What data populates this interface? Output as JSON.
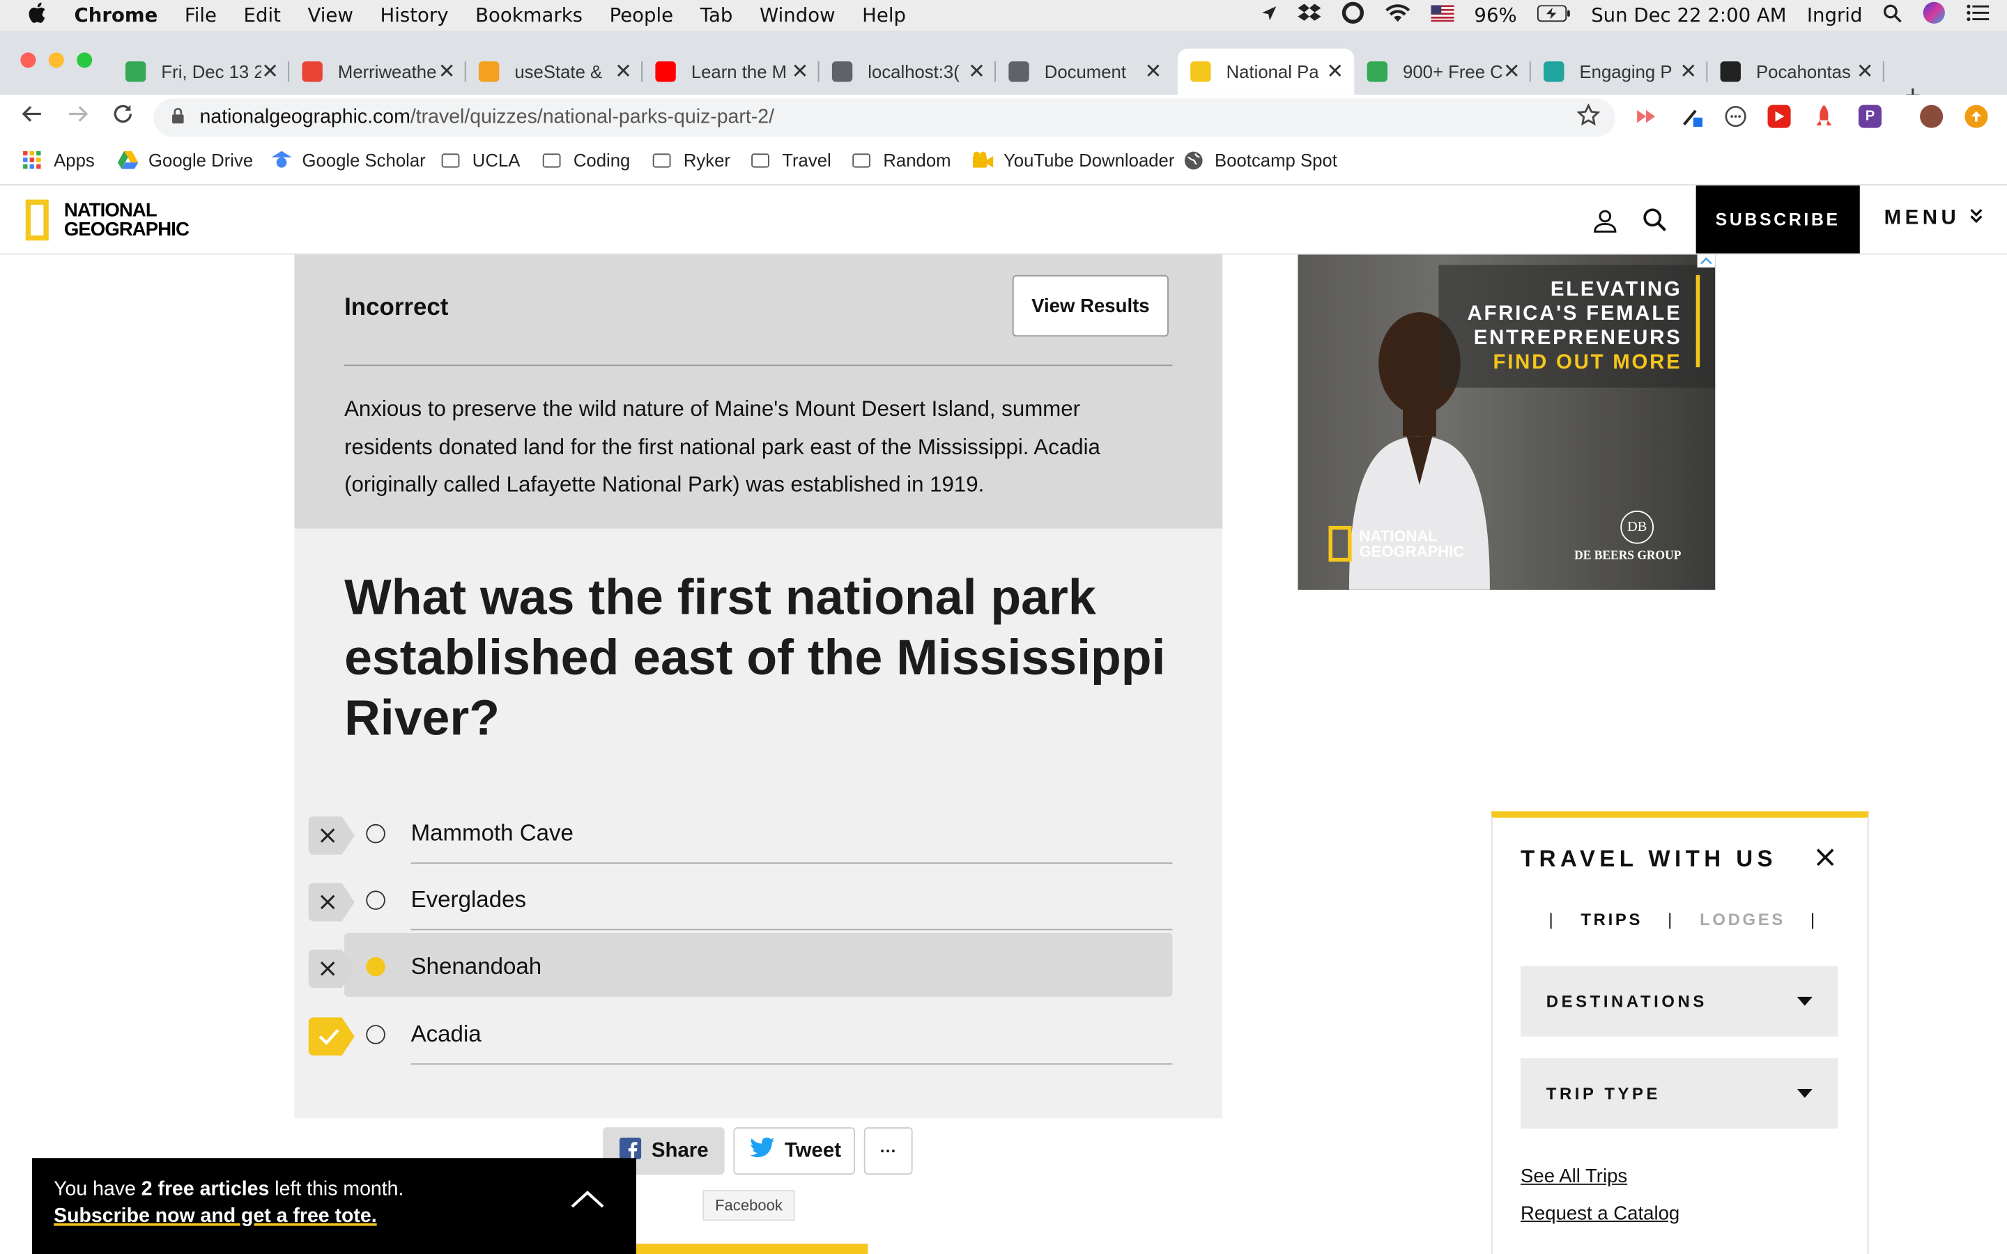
{
  "menubar": {
    "app": "Chrome",
    "items": [
      "File",
      "Edit",
      "View",
      "History",
      "Bookmarks",
      "People",
      "Tab",
      "Window",
      "Help"
    ],
    "battery": "96%",
    "datetime": "Sun Dec 22  2:00 AM",
    "user": "Ingrid"
  },
  "tabs": [
    {
      "title": "Fri, Dec 13 2",
      "color": "#34a853"
    },
    {
      "title": "Merriweathe",
      "color": "#ea4335"
    },
    {
      "title": "useState &",
      "color": "#f4a020"
    },
    {
      "title": "Learn the M",
      "color": "#ff0000"
    },
    {
      "title": "localhost:3(",
      "color": "#5f6368"
    },
    {
      "title": "Document",
      "color": "#5f6368"
    },
    {
      "title": "National Pa",
      "color": "#f5c61b"
    },
    {
      "title": "900+ Free C",
      "color": "#34a853"
    },
    {
      "title": "Engaging P",
      "color": "#20a4a0"
    },
    {
      "title": "Pocahontas",
      "color": "#222222"
    }
  ],
  "address": {
    "host": "nationalgeographic.com",
    "path": "/travel/quizzes/national-parks-quiz-part-2/"
  },
  "bookmarks": [
    "Apps",
    "Google Drive",
    "Google Scholar",
    "UCLA",
    "Coding",
    "Ryker",
    "Travel",
    "Random",
    "YouTube Downloader",
    "Bootcamp Spot"
  ],
  "site": {
    "logo_line1": "NATIONAL",
    "logo_line2": "GEOGRAPHIC",
    "subscribe": "SUBSCRIBE",
    "menu": "MENU"
  },
  "quiz": {
    "result": "Incorrect",
    "view_results": "View Results",
    "explanation": "Anxious to preserve the wild nature of Maine's Mount Desert Island, summer residents donated land for the first national park east of the Mississippi. Acadia (originally called Lafayette National Park) was established in 1919.",
    "question": "What was the first national park established east of the Mississippi River?",
    "answers": [
      {
        "label": "Mammoth Cave",
        "status": "wrong",
        "selected": false
      },
      {
        "label": "Everglades",
        "status": "wrong",
        "selected": false
      },
      {
        "label": "Shenandoah",
        "status": "wrong",
        "selected": true
      },
      {
        "label": "Acadia",
        "status": "correct",
        "selected": false
      }
    ],
    "share": "Share",
    "tweet": "Tweet",
    "more": "···",
    "tooltip": "Facebook"
  },
  "ad": {
    "line1": "ELEVATING",
    "line2": "AFRICA'S FEMALE",
    "line3": "ENTREPRENEURS",
    "cta": "FIND OUT MORE",
    "brand1": "NATIONAL",
    "brand2": "GEOGRAPHIC",
    "sponsor_badge": "DB",
    "sponsor": "DE BEERS GROUP"
  },
  "travel": {
    "title": "TRAVEL WITH US",
    "tab_active": "TRIPS",
    "tab_inactive": "LODGES",
    "dropdown1": "DESTINATIONS",
    "dropdown2": "TRIP TYPE",
    "link1": "See All Trips",
    "link2": "Request a Catalog"
  },
  "paywall": {
    "prefix": "You have ",
    "count": "2 free articles",
    "suffix": " left this month.",
    "cta": "Subscribe now and get a free tote."
  },
  "colors": {
    "brand_yellow": "#f5c61b",
    "feedback_bg": "#d9d9d9",
    "quiz_bg": "#f0f0f0"
  }
}
